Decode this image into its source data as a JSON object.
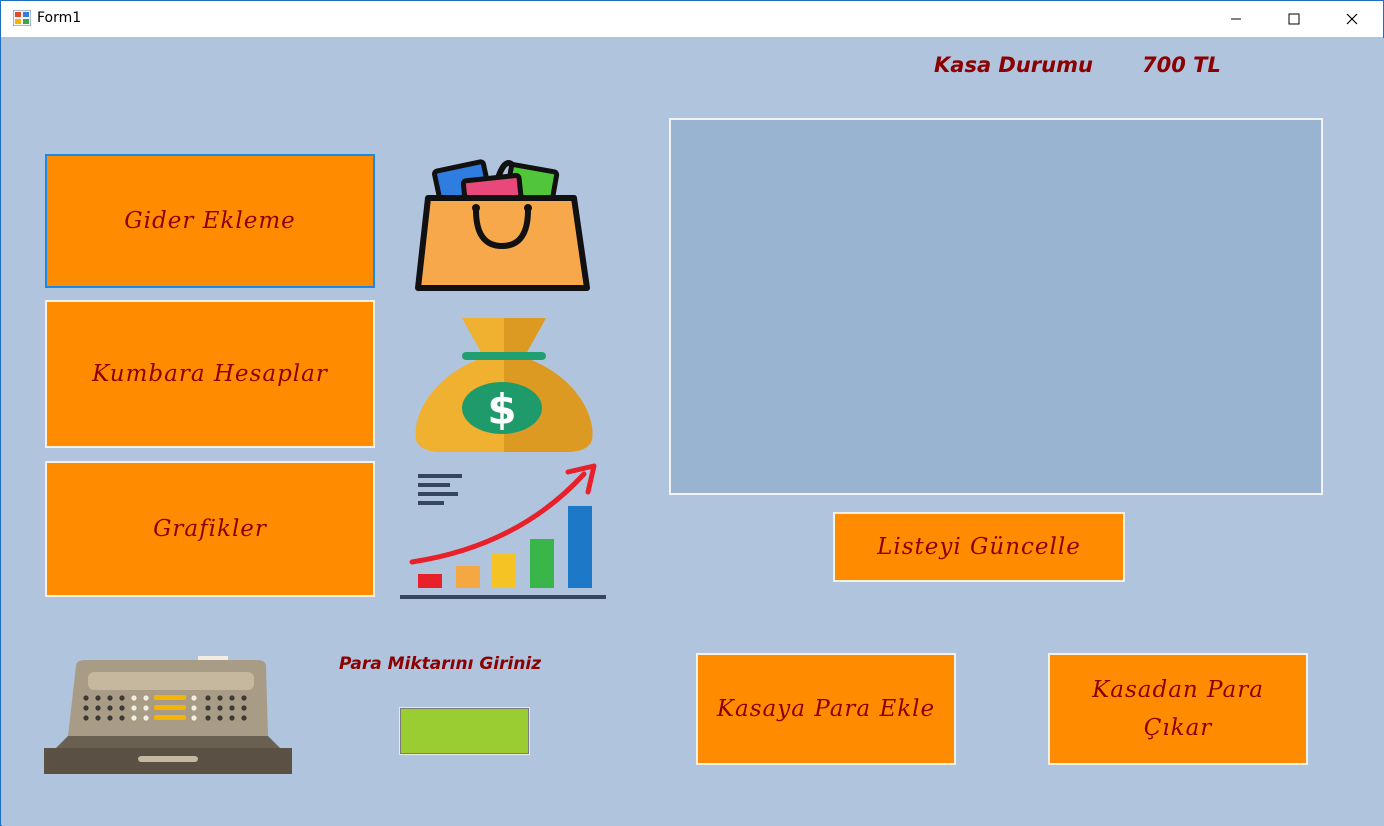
{
  "window": {
    "title": "Form1",
    "controls": {
      "minimize": "minimize-icon",
      "maximize": "maximize-icon",
      "close": "close-icon"
    }
  },
  "header": {
    "kasa_label": "Kasa Durumu",
    "kasa_value": "700 TL"
  },
  "buttons": {
    "gider_ekleme": "Gider Ekleme",
    "kumbara_hesaplar": "Kumbara Hesaplar",
    "grafikler": "Grafikler",
    "listeyi_guncelle": "Listeyi Güncelle",
    "kasaya_para_ekle": "Kasaya Para Ekle",
    "kasadan_para_cikar": "Kasadan Para Çıkar"
  },
  "amount": {
    "label": "Para Miktarını Giriniz",
    "value": ""
  },
  "icons": [
    "shopping-bag-icon",
    "money-bag-icon",
    "growth-chart-icon",
    "cash-register-icon"
  ],
  "colors": {
    "background": "#b0c4de",
    "button": "#ff8c00",
    "text_accent": "#8b0000",
    "listbox": "#99b4d1",
    "input": "#9acd32"
  }
}
